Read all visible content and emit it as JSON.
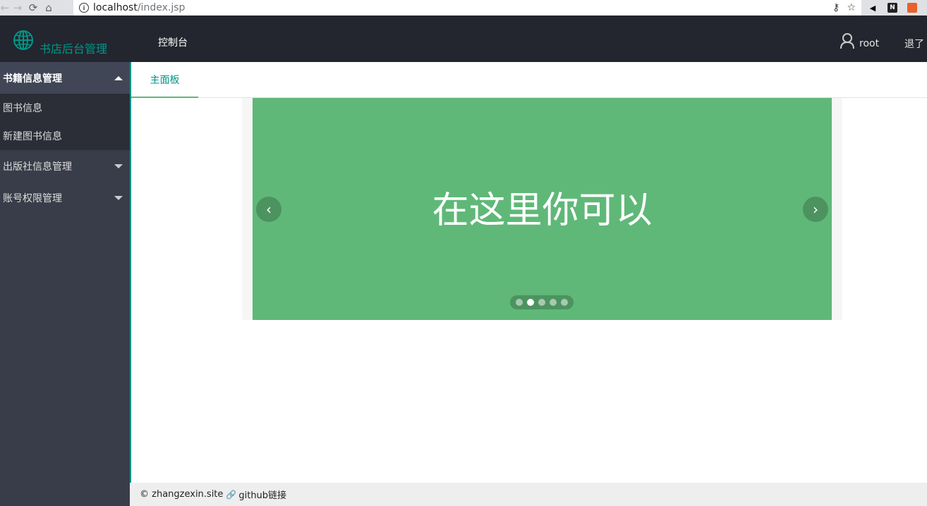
{
  "browser": {
    "url_host": "localhost",
    "url_path": "/index.jsp"
  },
  "header": {
    "brand": "书店后台管理",
    "nav_item": "控制台",
    "user_name": "root",
    "logout_label": "退了"
  },
  "sidebar": {
    "groups": [
      {
        "label": "书籍信息管理",
        "expanded": true,
        "children": [
          "图书信息",
          "新建图书信息"
        ]
      },
      {
        "label": "出版社信息管理",
        "expanded": false
      },
      {
        "label": "账号权限管理",
        "expanded": false
      }
    ]
  },
  "main": {
    "tab_label": "主面板",
    "carousel": {
      "slide_text": "在这里你可以",
      "slide_count": 5,
      "active_index": 1,
      "background": "#5fb878"
    }
  },
  "footer": {
    "copyright": "© zhangzexin.site",
    "github_link": "github链接"
  },
  "colors": {
    "accent": "#009688",
    "header_bg": "#23262e",
    "sidebar_bg": "#393d49"
  }
}
